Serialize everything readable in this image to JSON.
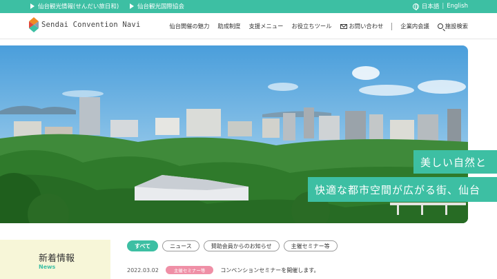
{
  "topbar": {
    "link1": "仙台観光情報(せんだい旅日和)",
    "link2": "仙台観光国際協会",
    "lang_ja": "日本語",
    "lang_sep": "|",
    "lang_en": "English"
  },
  "header": {
    "logo_text": "Sendai Convention Navi",
    "nav": [
      "仙台開催の魅力",
      "助成制度",
      "支援メニュー",
      "お役立ちツール",
      "お問い合わせ",
      "企業内会議",
      "施設検索"
    ]
  },
  "hero": {
    "caption_line1": "美しい自然と",
    "caption_line2": "快適な都市空間が広がる街、仙台"
  },
  "news": {
    "title": "新着情報",
    "subtitle": "News",
    "filters": [
      "すべて",
      "ニュース",
      "賛助会員からのお知らせ",
      "主催セミナー等"
    ],
    "items": [
      {
        "date": "2022.03.02",
        "tag": "主催セミナー等",
        "text": "コンベンションセミナーを開催します。"
      }
    ]
  },
  "colors": {
    "accent": "#3dbfa3",
    "news_bg": "#f7f6d8",
    "tag_pink": "#ef8fa6"
  }
}
